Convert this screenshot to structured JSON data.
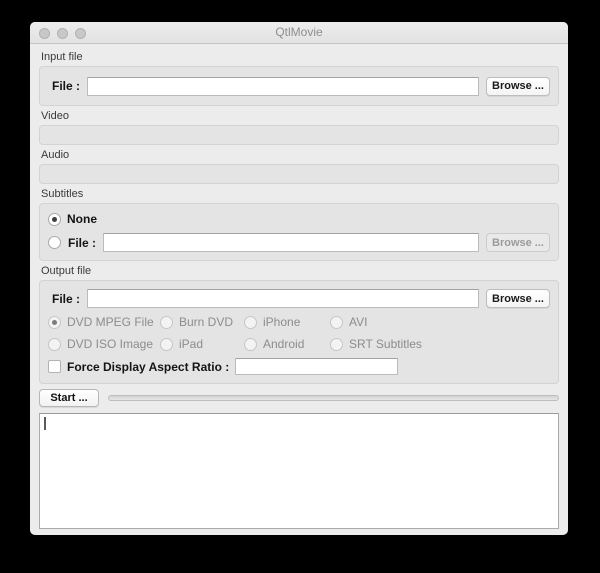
{
  "window": {
    "title": "QtlMovie",
    "state": "inactive"
  },
  "input_file": {
    "section_label": "Input file",
    "file_label": "File :",
    "file_value": "",
    "browse_label": "Browse ..."
  },
  "video": {
    "section_label": "Video"
  },
  "audio": {
    "section_label": "Audio"
  },
  "subtitles": {
    "section_label": "Subtitles",
    "none_label": "None",
    "none_selected": true,
    "file_label": "File :",
    "file_value": "",
    "file_selected": false,
    "browse_label": "Browse ...",
    "browse_enabled": false
  },
  "output_file": {
    "section_label": "Output file",
    "file_label": "File :",
    "file_value": "",
    "browse_label": "Browse ...",
    "formats": [
      [
        "DVD MPEG File",
        "Burn DVD",
        "iPhone",
        "AVI"
      ],
      [
        "DVD ISO Image",
        "iPad",
        "Android",
        "SRT Subtitles"
      ]
    ],
    "selected_format": "DVD MPEG File",
    "formats_enabled": false,
    "aspect_checkbox_label": "Force Display Aspect Ratio :",
    "aspect_checked": false,
    "aspect_value": ""
  },
  "actions": {
    "start_label": "Start ...",
    "progress_percent": 0
  },
  "log": {
    "value": ""
  },
  "colors": {
    "desktop_bg": "#000000",
    "window_bg": "#ECECEC",
    "groupbox_bg": "#E4E4E4",
    "titlebar_text": "#8E8E8E",
    "disabled_text": "#8C8C8C"
  }
}
